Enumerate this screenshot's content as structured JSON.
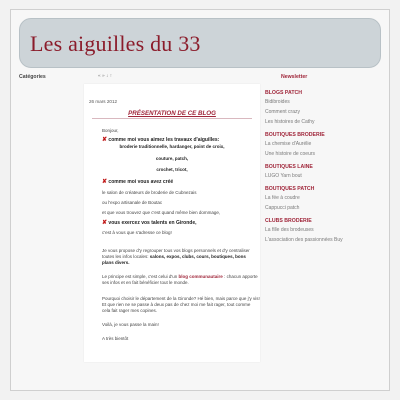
{
  "blog": {
    "title": "Les aiguilles du 33"
  },
  "sidebar_left": {
    "heading": "Catégories"
  },
  "top_dropdown": "« » ↓ ↑",
  "post": {
    "date": "26 mars 2012",
    "title": "PRÉSENTATION DE CE BLOG",
    "greeting": "Bonjour,",
    "q1": "comme moi vous aimez les travaux d'aiguilles:",
    "q1_list": [
      "broderie traditionnelle, hardanger, point de croix,",
      "couture, patch,",
      "crochet, tricot,"
    ],
    "q2": "comme moi vous avez créé",
    "p1": "le salon de créateurs de broderie de Cubnezais",
    "p2": "ou l'expo artisanale de Boutac",
    "p3": "et que vous trouvez que c'est quand même bien dommage,",
    "q3": "vous exercez vos talents en Gironde,",
    "p4": "c'est à vous que s'adresse ce blog!",
    "p5a": "Je vous propose d'y regrouper tous vos blogs personnels et d'y centraliser",
    "p5b": "toutes les infos locales:",
    "p5c": "salons, expos, clubs, cours, boutiques, bons",
    "p5d": "plans divers.",
    "p6a": "Le principe est simple, c'est celui d'un",
    "p6b": "blog communautaire",
    "p6c": ": chacun apporte",
    "p6d": "ses infos et en fait bénéficier tout le monde.",
    "p7a": "Pourquoi choisir le département de la Gironde? Hé bien, mais parce que j'y vis!",
    "p7b": "Et que rien ne se passe à deux pas de chez moi me fait rager, tout comme",
    "p7c": "cela fait rager mes copines.",
    "p8": "Voilà, je vous passe la main!",
    "p9": "A très bientôt"
  },
  "sidebar_right": {
    "heading": "Newsletter",
    "sections": [
      {
        "title": "BLOGS PATCH",
        "links": [
          "Bidibroides",
          "Comment crazy",
          "Les histoires de Cathy"
        ]
      },
      {
        "title": "BOUTIQUES BRODERIE",
        "links": [
          "La chemise d'Aurélie",
          "Une histoire de coeurs"
        ]
      },
      {
        "title": "BOUTIQUES LAINE",
        "links": [
          "LUGO Yarn bout"
        ]
      },
      {
        "title": "BOUTIQUES PATCH",
        "links": [
          "La fée à coudre",
          "Cappucci patch"
        ]
      },
      {
        "title": "CLUBS BRODERIE",
        "links": [
          "La fille des brodeuses",
          "L'association des passionnées Buy"
        ]
      }
    ]
  },
  "colors": {
    "accent": "#a0263a",
    "header_bg": "#cdd4d8",
    "bullet_red": "#c01818"
  }
}
